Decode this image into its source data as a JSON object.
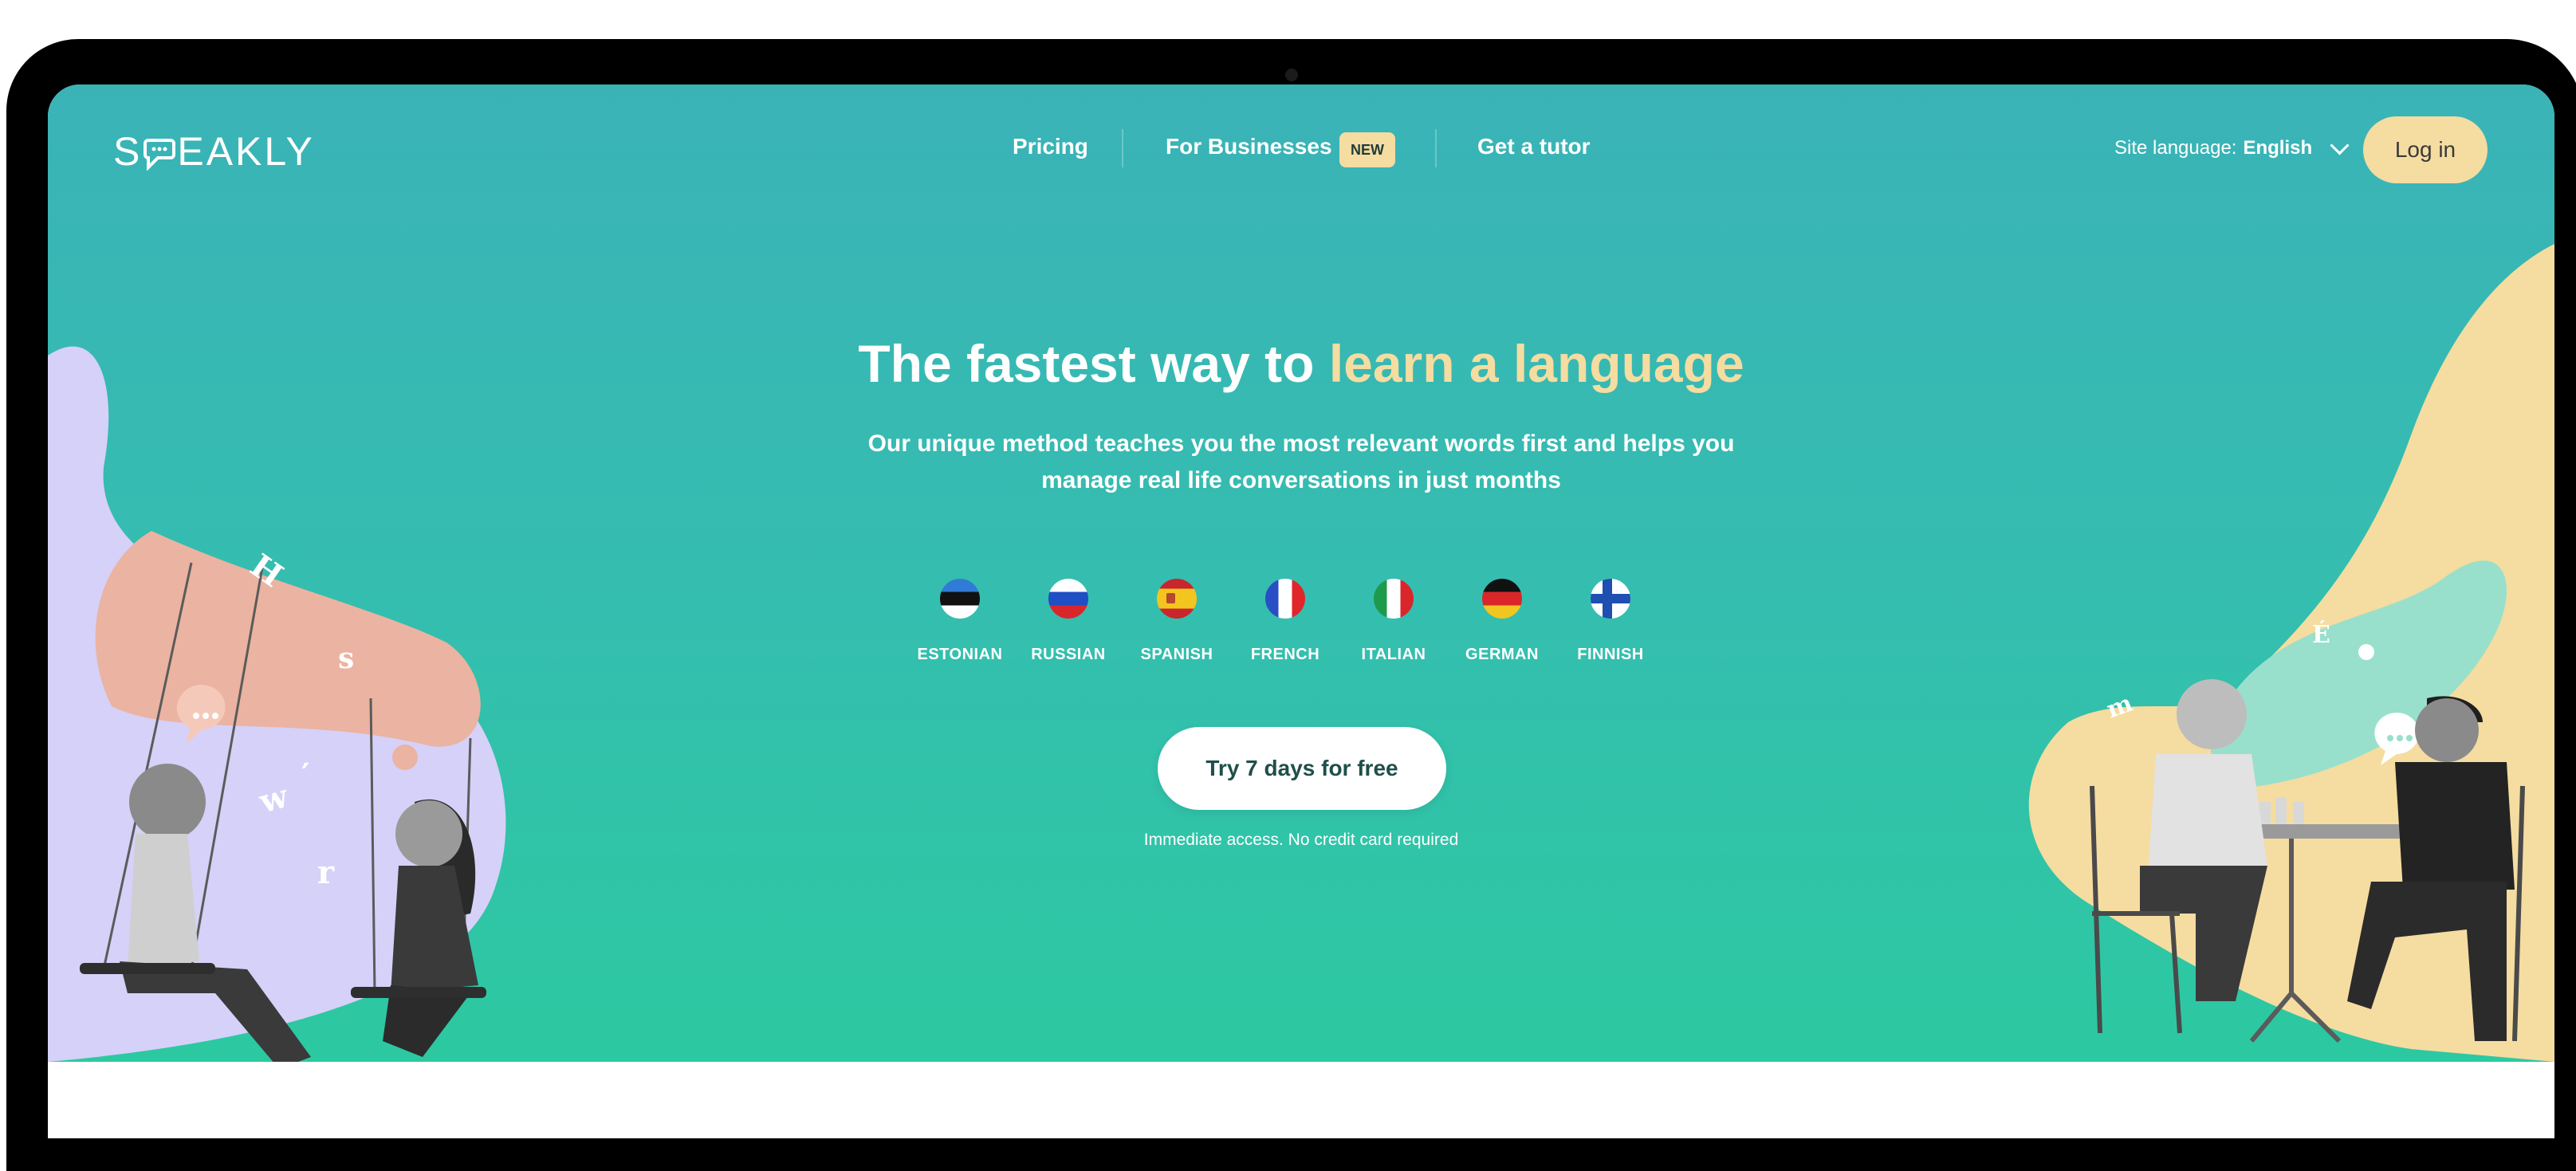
{
  "brand": {
    "logo_text_left": "S",
    "logo_text_right": "EAKLY"
  },
  "nav": {
    "pricing": "Pricing",
    "for_businesses": "For Businesses",
    "new_badge": "NEW",
    "get_tutor": "Get a tutor",
    "site_language_label": "Site language:",
    "site_language_value": "English",
    "login": "Log in"
  },
  "hero": {
    "headline_plain": "The fastest way to",
    "headline_accent": "learn a language",
    "subtitle_line1": "Our unique method teaches you the most relevant words first and helps you",
    "subtitle_line2": "manage real life conversations in just months",
    "cta": "Try 7 days for free",
    "fine_print": "Immediate access. No credit card required"
  },
  "languages": [
    {
      "label": "ESTONIAN",
      "icon": "estonia-flag-icon"
    },
    {
      "label": "RUSSIAN",
      "icon": "russia-flag-icon"
    },
    {
      "label": "SPANISH",
      "icon": "spain-flag-icon"
    },
    {
      "label": "FRENCH",
      "icon": "france-flag-icon"
    },
    {
      "label": "ITALIAN",
      "icon": "italy-flag-icon"
    },
    {
      "label": "GERMAN",
      "icon": "germany-flag-icon"
    },
    {
      "label": "FINNISH",
      "icon": "finland-flag-icon"
    }
  ],
  "illustration_letters": {
    "left": [
      "H",
      "s",
      "w",
      "′",
      "r"
    ],
    "right": [
      "É",
      "m"
    ]
  },
  "colors": {
    "accent": "#f5dca0",
    "hero_top": "#3ab3b7",
    "hero_bottom": "#2cc9a1",
    "lavender": "#d5d1f8",
    "peach": "#ebb3a1",
    "mint": "#98e0cc"
  }
}
